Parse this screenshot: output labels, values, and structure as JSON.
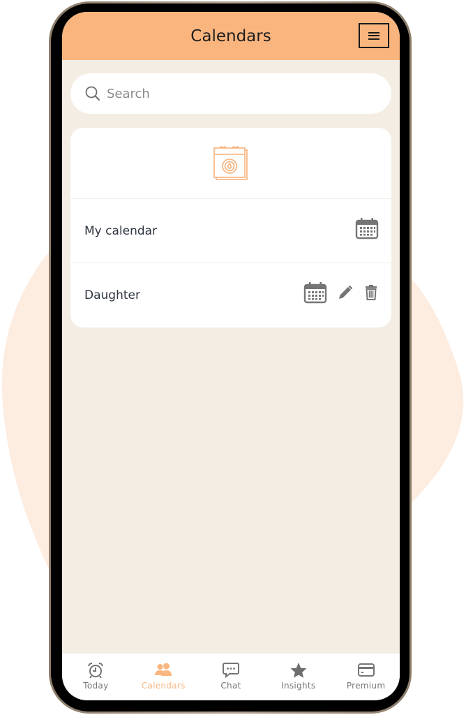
{
  "colors": {
    "accent": "#fab57e",
    "background": "#f4ede4",
    "blob": "#fdece0",
    "icon_gray": "#757575",
    "text_dark": "#2f3640"
  },
  "header": {
    "title": "Calendars",
    "menu_icon": "hamburger-menu-icon"
  },
  "search": {
    "placeholder": "Search",
    "value": "",
    "icon": "search-icon"
  },
  "card": {
    "header_icon": "calendar-drop-icon",
    "calendars": [
      {
        "name": "My calendar",
        "actions": [
          "calendar-icon"
        ]
      },
      {
        "name": "Daughter",
        "actions": [
          "calendar-icon",
          "pencil-icon",
          "trash-icon"
        ]
      }
    ]
  },
  "tabbar": {
    "active": "Calendars",
    "tabs": [
      {
        "label": "Today",
        "icon": "alarm-clock-icon"
      },
      {
        "label": "Calendars",
        "icon": "users-icon"
      },
      {
        "label": "Chat",
        "icon": "chat-bubble-icon"
      },
      {
        "label": "Insights",
        "icon": "star-icon"
      },
      {
        "label": "Premium",
        "icon": "credit-card-icon"
      }
    ]
  }
}
